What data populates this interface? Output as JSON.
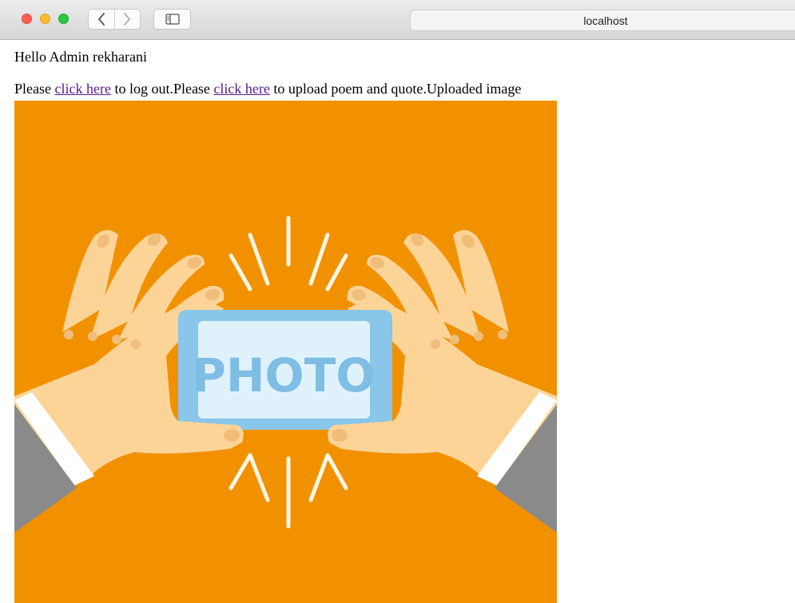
{
  "browser": {
    "url": "localhost",
    "icons": {
      "back": "chevron-left-icon",
      "forward": "chevron-right-icon",
      "sidebar": "sidebar-icon"
    }
  },
  "page": {
    "greeting": "Hello Admin rekharani",
    "text_please_1": "Please ",
    "logout_link": "click here",
    "text_logout": " to log out.Please ",
    "upload_link": "click here",
    "text_upload": " to upload poem and quote.Uploaded image",
    "image_label": "PHOTO"
  },
  "colors": {
    "link_visited": "#551a8b",
    "image_background": "#f19100",
    "hand": "#fdd497",
    "nail": "#f0bd7a",
    "phone_frame": "#89c6ea",
    "phone_screen": "#dff2fb",
    "photo_text": "#7fbde5",
    "sleeve": "#8a8a8a"
  }
}
